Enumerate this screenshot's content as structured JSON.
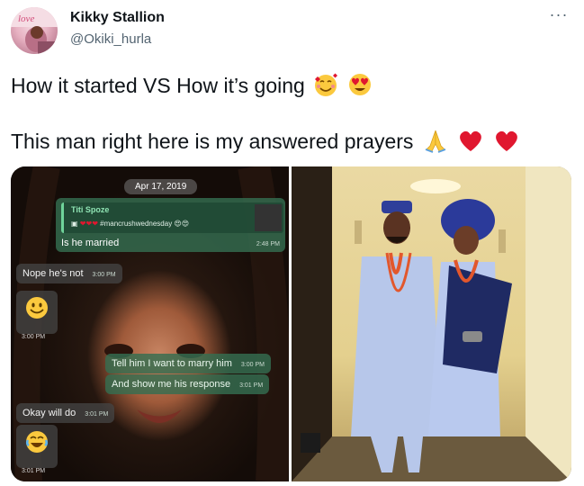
{
  "user": {
    "display_name": "Kikky Stallion",
    "handle": "@Okiki_hurla"
  },
  "menu": {
    "more_label": "···"
  },
  "tweet": {
    "line1": "How it started VS How it’s going",
    "line1_emojis": [
      "smiling-face-with-hearts",
      "heart-eyes"
    ],
    "line2": "This man right here is my answered prayers",
    "line2_emojis": [
      "folded-hands",
      "red-heart",
      "red-heart"
    ]
  },
  "media": {
    "left_image": {
      "date_chip": "Apr 17, 2019",
      "reply_card": {
        "name": "Titi Spoze",
        "snippet": "#mancrushwednesday",
        "text": "Is he married",
        "time": "2:48 PM"
      },
      "messages": [
        {
          "side": "in",
          "text": "Nope he's not",
          "time": "3:00 PM"
        },
        {
          "side": "in",
          "emoji": "smiley",
          "time": "3:00 PM"
        },
        {
          "side": "out",
          "text": "Tell him I want to marry him",
          "time": "3:00 PM"
        },
        {
          "side": "out",
          "text": "And show me his response",
          "time": "3:01 PM"
        },
        {
          "side": "in",
          "text": "Okay will do",
          "time": "3:01 PM"
        },
        {
          "side": "in",
          "emoji": "laughing-tears",
          "time": "3:01 PM"
        }
      ]
    },
    "right_image": {
      "description_icon": "couple-photo"
    }
  },
  "colors": {
    "accent": "#0f1419",
    "secondary_text": "#536471",
    "heart": "#e0172f",
    "whatsapp_out": "#346e50"
  }
}
